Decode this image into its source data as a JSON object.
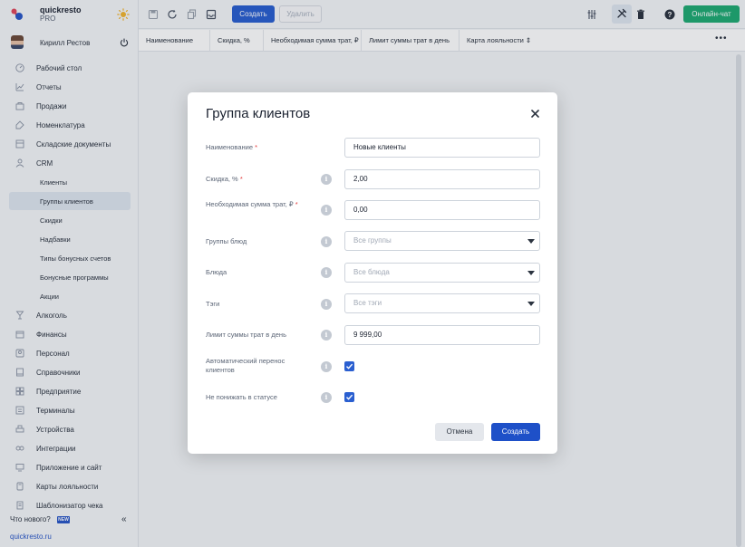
{
  "brand": {
    "name": "quickresto",
    "plan": "PRO"
  },
  "user": {
    "name": "Кирилл Рестов"
  },
  "sidebar": {
    "items": [
      {
        "label": "Рабочий стол",
        "icon": "gauge-icon"
      },
      {
        "label": "Отчеты",
        "icon": "chart-icon"
      },
      {
        "label": "Продажи",
        "icon": "cart-icon"
      },
      {
        "label": "Номенклатура",
        "icon": "tag-icon"
      },
      {
        "label": "Складские документы",
        "icon": "warehouse-icon"
      },
      {
        "label": "CRM",
        "icon": "people-icon"
      },
      {
        "label": "Клиенты"
      },
      {
        "label": "Группы клиентов"
      },
      {
        "label": "Скидки"
      },
      {
        "label": "Надбавки"
      },
      {
        "label": "Типы бонусных счетов"
      },
      {
        "label": "Бонусные программы"
      },
      {
        "label": "Акции"
      },
      {
        "label": "Алкоголь",
        "icon": "glass-icon"
      },
      {
        "label": "Финансы",
        "icon": "wallet-icon"
      },
      {
        "label": "Персонал",
        "icon": "person-icon"
      },
      {
        "label": "Справочники",
        "icon": "book-icon"
      },
      {
        "label": "Предприятие",
        "icon": "building-icon"
      },
      {
        "label": "Терминалы",
        "icon": "terminal-icon"
      },
      {
        "label": "Устройства",
        "icon": "printer-icon"
      },
      {
        "label": "Интеграции",
        "icon": "infinity-icon"
      },
      {
        "label": "Приложение и сайт",
        "icon": "monitor-icon"
      },
      {
        "label": "Карты лояльности",
        "icon": "card-icon"
      },
      {
        "label": "Шаблонизатор чека",
        "icon": "receipt-icon"
      }
    ],
    "whats_new": "Что нового?",
    "new_badge": "NEW",
    "site_link": "quickresto.ru"
  },
  "toolbar": {
    "create_label": "Создать",
    "delete_label": "Удалить",
    "chat_label": "Онлайн-чат"
  },
  "table": {
    "columns": [
      "Наименование",
      "Скидка, %",
      "Необходимая сумма трат, ₽",
      "Лимит суммы трат в день",
      "Карта лояльности ⇕"
    ]
  },
  "modal": {
    "title": "Группа клиентов",
    "fields": {
      "name": {
        "label": "Наименование",
        "value": "Новые клиенты"
      },
      "discount": {
        "label": "Скидка, %",
        "value": "2,00"
      },
      "required_sum": {
        "label": "Необходимая сумма трат, ₽",
        "value": "0,00"
      },
      "dish_groups": {
        "label": "Группы блюд",
        "placeholder": "Все группы"
      },
      "dishes": {
        "label": "Блюда",
        "placeholder": "Все блюда"
      },
      "tags": {
        "label": "Тэги",
        "placeholder": "Все тэги"
      },
      "daily_limit": {
        "label": "Лимит суммы трат в день",
        "value": "9 999,00"
      },
      "auto_transfer": {
        "label": "Автоматический перенос клиентов",
        "checked": true
      },
      "no_downgrade": {
        "label": "Не понижать в статусе",
        "checked": true
      }
    },
    "required_mark": "*",
    "info_glyph": "i",
    "cancel_label": "Отмена",
    "create_label": "Создать"
  },
  "colors": {
    "primary": "#2a5fd0",
    "chat": "#1faa72",
    "required": "#e23b3b"
  }
}
